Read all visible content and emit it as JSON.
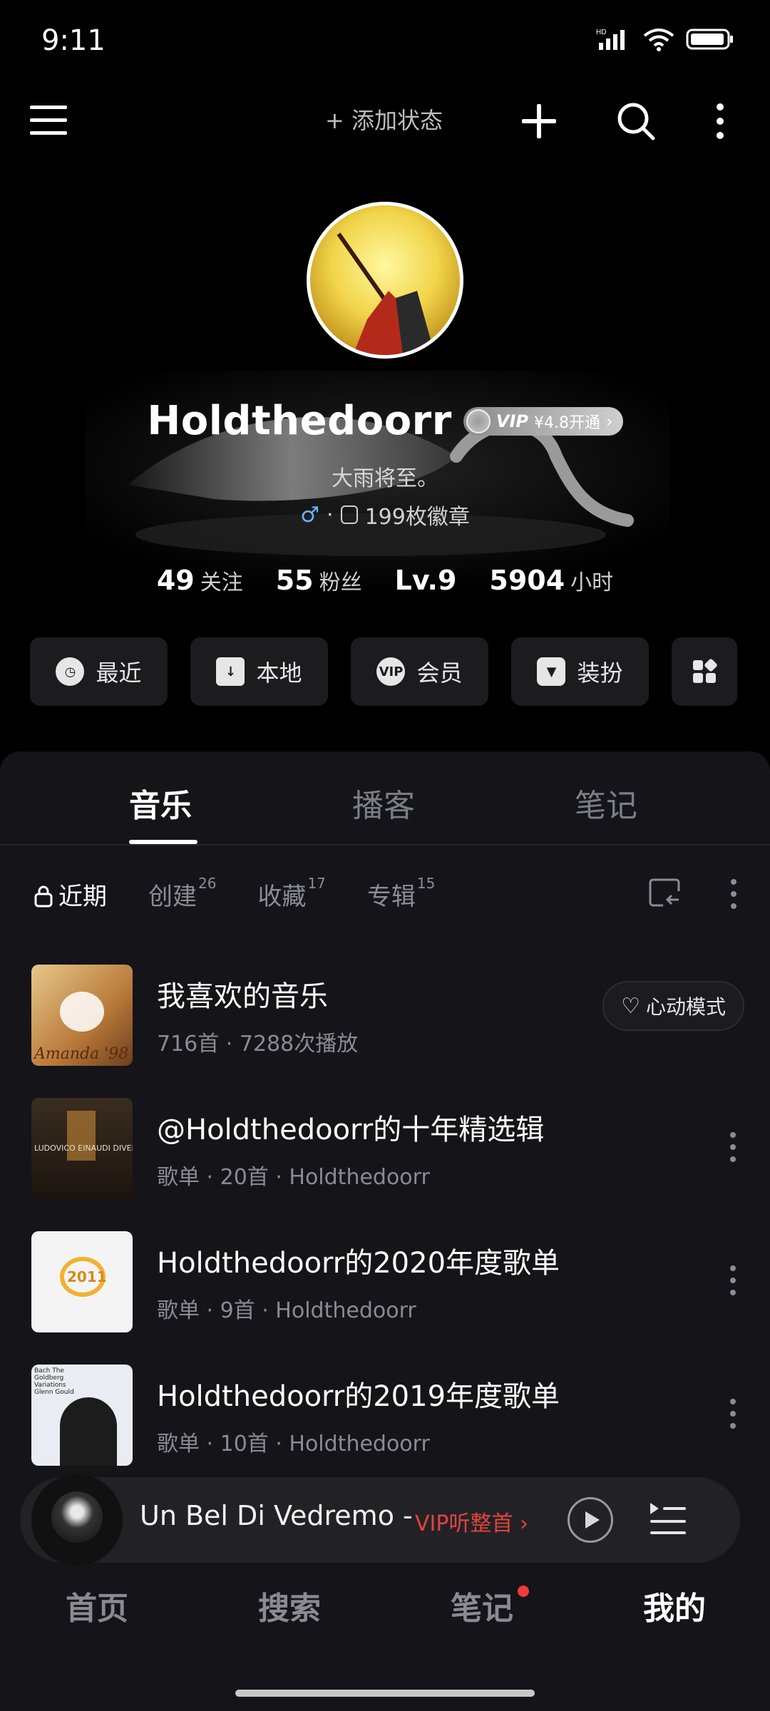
{
  "status_bar": {
    "time": "9:11"
  },
  "top_bar": {
    "add_status": "+ 添加状态"
  },
  "profile": {
    "username": "Holdthedoorr",
    "vip_label": "VIP",
    "vip_offer": "¥4.8开通",
    "bio": "大雨将至。",
    "gender_symbol": "♂",
    "badges": "199枚徽章",
    "stats": [
      {
        "num": "49",
        "label": "关注"
      },
      {
        "num": "55",
        "label": "粉丝"
      },
      {
        "num": "Lv.9",
        "label": ""
      },
      {
        "num": "5904",
        "label": "小时"
      }
    ]
  },
  "quick_actions": [
    {
      "label": "最近",
      "icon": "clock-icon"
    },
    {
      "label": "本地",
      "icon": "download-icon"
    },
    {
      "label": "会员",
      "icon": "vip-icon"
    },
    {
      "label": "装扮",
      "icon": "shirt-icon"
    }
  ],
  "tabs": [
    "音乐",
    "播客",
    "笔记"
  ],
  "sub_tabs": {
    "recent": "近期",
    "created": "创建",
    "created_count": "26",
    "collected": "收藏",
    "collected_count": "17",
    "albums": "专辑",
    "albums_count": "15"
  },
  "playlists": [
    {
      "title": "我喜欢的音乐",
      "subtitle": "716首 · 7288次播放",
      "cover_text": "Amanda '98"
    },
    {
      "title": "@Holdthedoorr的十年精选辑",
      "subtitle": "歌单 · 20首 · Holdthedoorr",
      "cover_text": "LUDOVICO EINAUDI DIVENIRE"
    },
    {
      "title": "Holdthedoorr的2020年度歌单",
      "subtitle": "歌单 · 9首 · Holdthedoorr",
      "cover_text": "2011"
    },
    {
      "title": "Holdthedoorr的2019年度歌单",
      "subtitle": "歌单 · 10首 · Holdthedoorr",
      "cover_text": "Bach The Goldberg Variations Glenn Gould"
    }
  ],
  "heart_mode": "心动模式",
  "player": {
    "song": "Un Bel Di Vedremo -",
    "vip_listen": "VIP听整首 ›"
  },
  "bottom_nav": [
    "首页",
    "搜索",
    "笔记",
    "我的"
  ]
}
